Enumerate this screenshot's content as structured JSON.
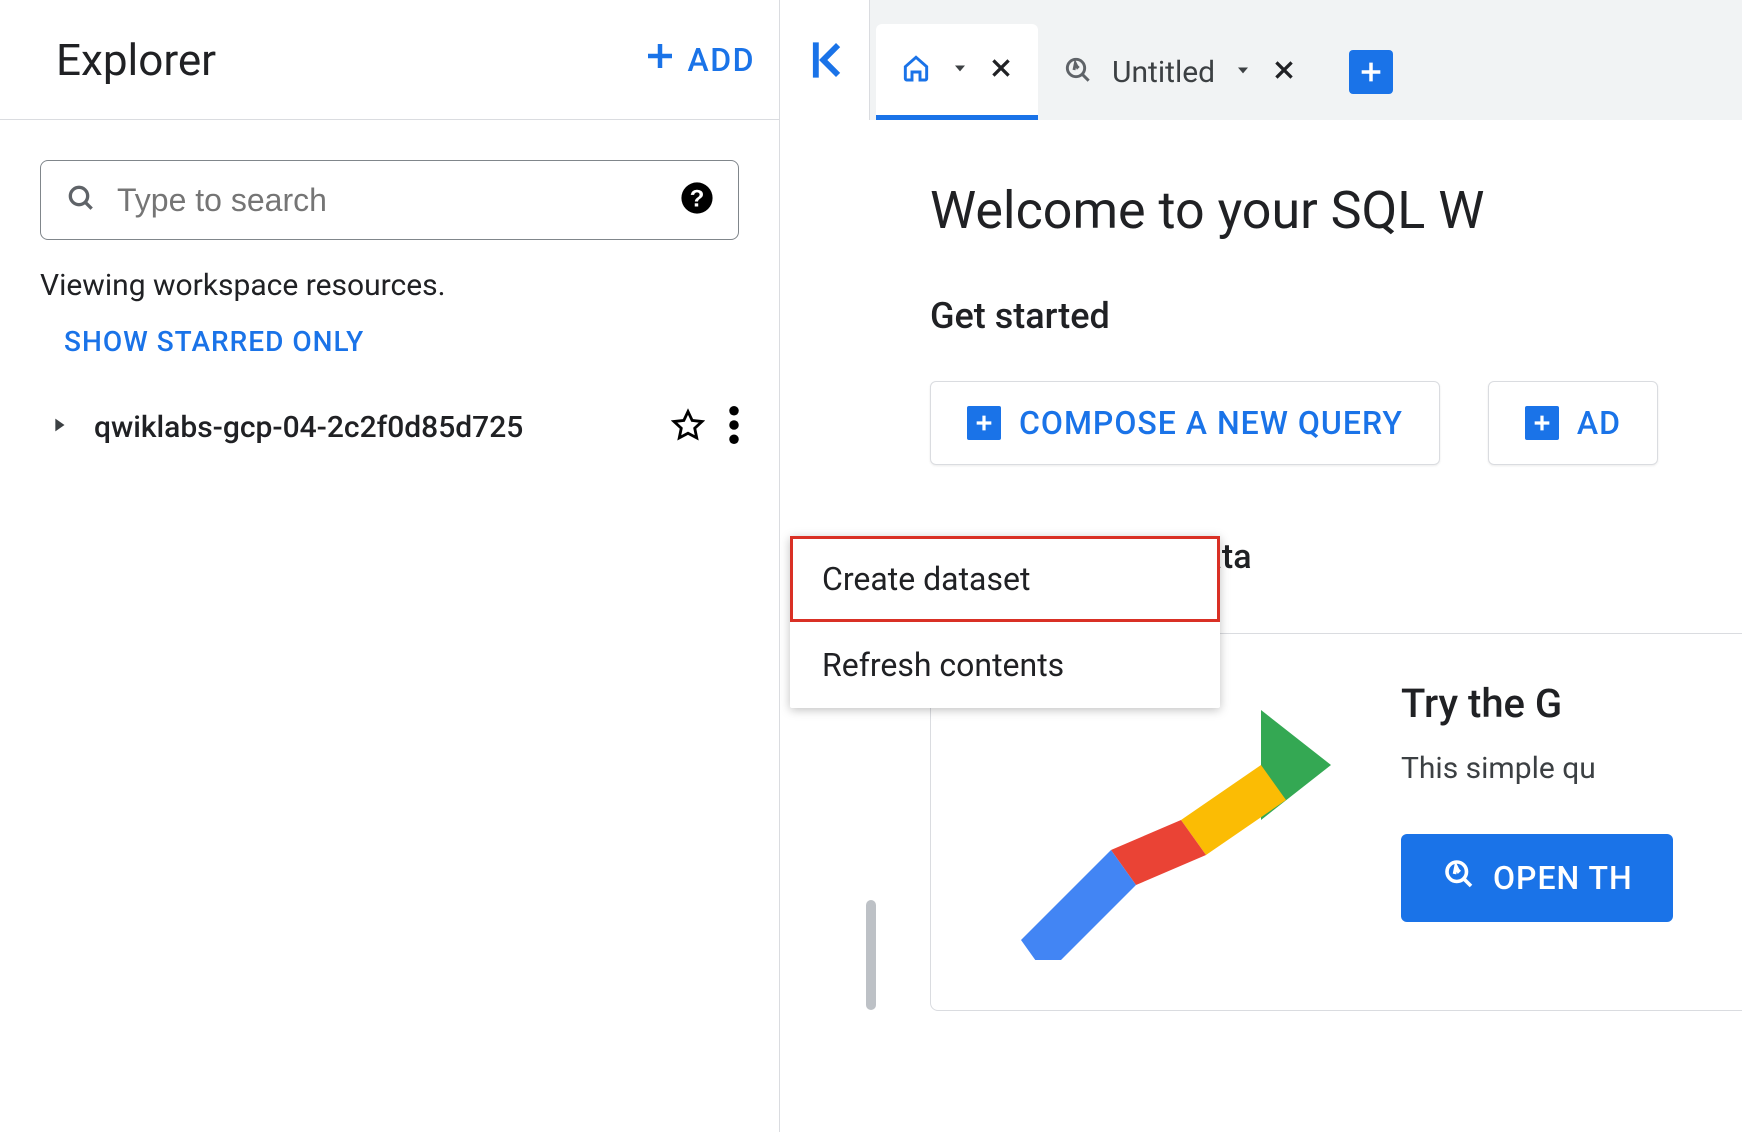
{
  "explorer": {
    "title": "Explorer",
    "add_label": "ADD",
    "search_placeholder": "Type to search",
    "viewing_text": "Viewing workspace resources.",
    "show_starred_label": "SHOW STARRED ONLY",
    "project_name": "qwiklabs-gcp-04-2c2f0d85d725"
  },
  "context_menu": {
    "items": [
      {
        "label": "Create dataset",
        "highlighted": true
      },
      {
        "label": "Refresh contents",
        "highlighted": false
      }
    ]
  },
  "tabs": {
    "home_active": true,
    "untitled_label": "Untitled"
  },
  "main": {
    "welcome_title": "Welcome to your SQL W",
    "get_started": "Get started",
    "compose_label": "COMPOSE A NEW QUERY",
    "add_label_partial": "AD",
    "sample_data_label_partial": "ple data",
    "card": {
      "title_partial": "Try the G",
      "subtitle_partial": "This simple qu",
      "open_label_partial": "OPEN TH"
    }
  },
  "colors": {
    "blue": "#1a73e8",
    "red": "#d93025",
    "yellow": "#fbbc04",
    "green": "#34a853"
  }
}
